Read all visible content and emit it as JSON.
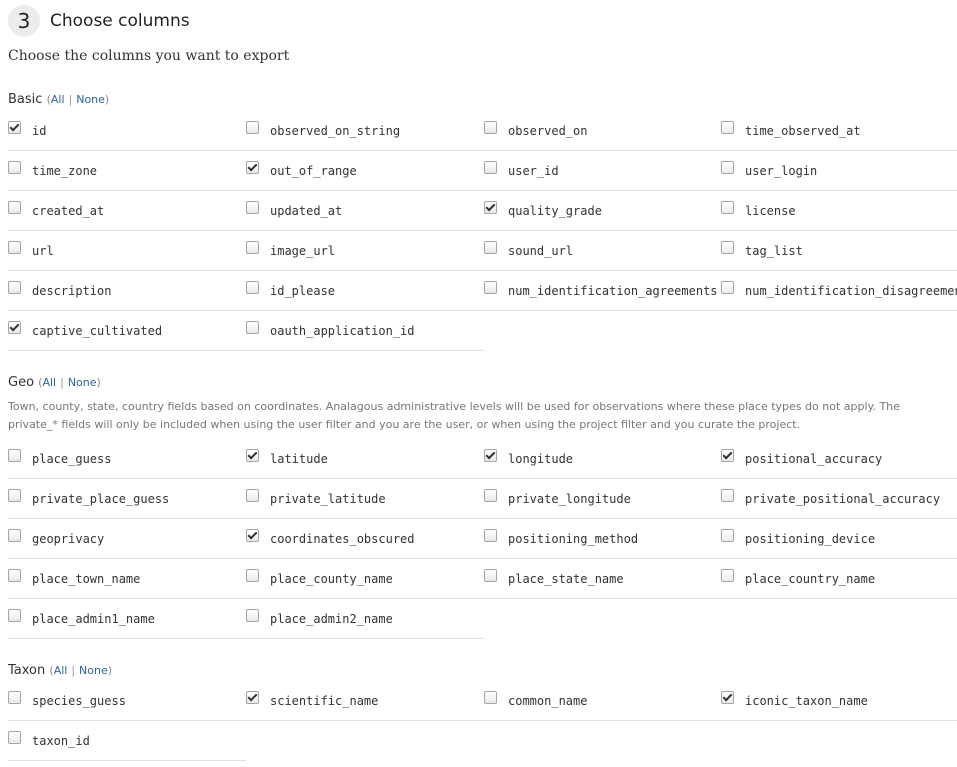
{
  "step": {
    "number": "3",
    "title": "Choose columns"
  },
  "intro": "Choose the columns you want to export",
  "toggle": {
    "all": "All",
    "sep": "|",
    "none": "None"
  },
  "groups": {
    "basic": {
      "title": "Basic",
      "rows": [
        [
          {
            "label": "id",
            "checked": true
          },
          {
            "label": "observed_on_string",
            "checked": false
          },
          {
            "label": "observed_on",
            "checked": false
          },
          {
            "label": "time_observed_at",
            "checked": false
          }
        ],
        [
          {
            "label": "time_zone",
            "checked": false
          },
          {
            "label": "out_of_range",
            "checked": true
          },
          {
            "label": "user_id",
            "checked": false
          },
          {
            "label": "user_login",
            "checked": false
          }
        ],
        [
          {
            "label": "created_at",
            "checked": false
          },
          {
            "label": "updated_at",
            "checked": false
          },
          {
            "label": "quality_grade",
            "checked": true
          },
          {
            "label": "license",
            "checked": false
          }
        ],
        [
          {
            "label": "url",
            "checked": false
          },
          {
            "label": "image_url",
            "checked": false
          },
          {
            "label": "sound_url",
            "checked": false
          },
          {
            "label": "tag_list",
            "checked": false
          }
        ],
        [
          {
            "label": "description",
            "checked": false
          },
          {
            "label": "id_please",
            "checked": false
          },
          {
            "label": "num_identification_agreements",
            "checked": false
          },
          {
            "label": "num_identification_disagreements",
            "checked": false
          }
        ],
        [
          {
            "label": "captive_cultivated",
            "checked": true
          },
          {
            "label": "oauth_application_id",
            "checked": false
          }
        ]
      ]
    },
    "geo": {
      "title": "Geo",
      "description": "Town, county, state, country fields based on coordinates. Analagous administrative levels will be used for observations where these place types do not apply. The private_* fields will only be included when using the user filter and you are the user, or when using the project filter and you curate the project.",
      "rows": [
        [
          {
            "label": "place_guess",
            "checked": false
          },
          {
            "label": "latitude",
            "checked": true
          },
          {
            "label": "longitude",
            "checked": true
          },
          {
            "label": "positional_accuracy",
            "checked": true
          }
        ],
        [
          {
            "label": "private_place_guess",
            "checked": false
          },
          {
            "label": "private_latitude",
            "checked": false
          },
          {
            "label": "private_longitude",
            "checked": false
          },
          {
            "label": "private_positional_accuracy",
            "checked": false
          }
        ],
        [
          {
            "label": "geoprivacy",
            "checked": false
          },
          {
            "label": "coordinates_obscured",
            "checked": true
          },
          {
            "label": "positioning_method",
            "checked": false
          },
          {
            "label": "positioning_device",
            "checked": false
          }
        ],
        [
          {
            "label": "place_town_name",
            "checked": false
          },
          {
            "label": "place_county_name",
            "checked": false
          },
          {
            "label": "place_state_name",
            "checked": false
          },
          {
            "label": "place_country_name",
            "checked": false
          }
        ],
        [
          {
            "label": "place_admin1_name",
            "checked": false
          },
          {
            "label": "place_admin2_name",
            "checked": false
          }
        ]
      ]
    },
    "taxon": {
      "title": "Taxon",
      "rows": [
        [
          {
            "label": "species_guess",
            "checked": false
          },
          {
            "label": "scientific_name",
            "checked": true
          },
          {
            "label": "common_name",
            "checked": false
          },
          {
            "label": "iconic_taxon_name",
            "checked": true
          }
        ],
        [
          {
            "label": "taxon_id",
            "checked": false
          }
        ]
      ]
    }
  }
}
